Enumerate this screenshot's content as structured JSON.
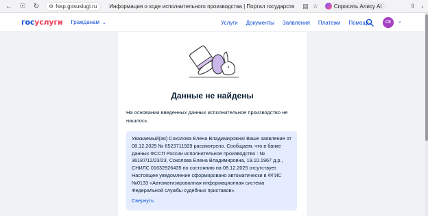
{
  "browser": {
    "host": "fssp.gosuslugi.ru",
    "tab_title": "Информация о ходе исполнительного производства | Портал государственных услуг Росси...",
    "alisa_label": "Спросить Алису AI"
  },
  "header": {
    "logo_part1": "гос",
    "logo_part2": "услуги",
    "audience": "Гражданам",
    "nav": [
      "Услуги",
      "Документы",
      "Заявления",
      "Платежи",
      "Помощь"
    ],
    "avatar_initials": "СЕ"
  },
  "colors": {
    "brand_blue": "#0d4cd3",
    "brand_red": "#ee3f58",
    "notice_bg": "#e4ecfd",
    "avatar": "#a53fc2"
  },
  "main": {
    "title": "Данные не найдены",
    "description": "На основании введенных данных исполнительное производство не нашлось",
    "notice_text": "Уважаемый(ая) Соколова Елена Владимировна! Ваше заявление от 08.12.2025 № 6523711929 рассмотрено. Сообщаем, что в банке данных ФССП России исполнительное производство : № 36187/12/23/23, Соколова Елена Владимировна, 19.10.1967 д.р., СНИЛС 01632926435 по состоянию на 08.12.2025 отсутствует. Настоящее уведомление сформировано автоматически в ФГИС №0133 «Автоматизированная информационная система Федеральной службы судебных приставов».",
    "collapse_label": "Свернуть"
  }
}
